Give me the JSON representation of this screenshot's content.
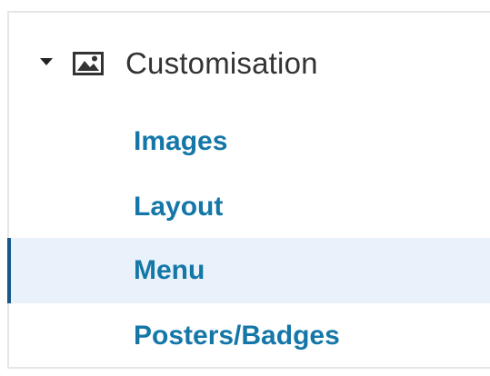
{
  "section": {
    "title": "Customisation",
    "caret_icon": "caret-down-icon",
    "image_icon": "image-icon"
  },
  "menu": {
    "items": [
      {
        "label": "Images"
      },
      {
        "label": "Layout"
      },
      {
        "label": "Menu",
        "active": true
      },
      {
        "label": "Posters/Badges"
      }
    ]
  },
  "colors": {
    "link": "#1477a8",
    "active_bg": "#e9f1fb",
    "active_bar": "#17578a",
    "title": "#333333"
  }
}
